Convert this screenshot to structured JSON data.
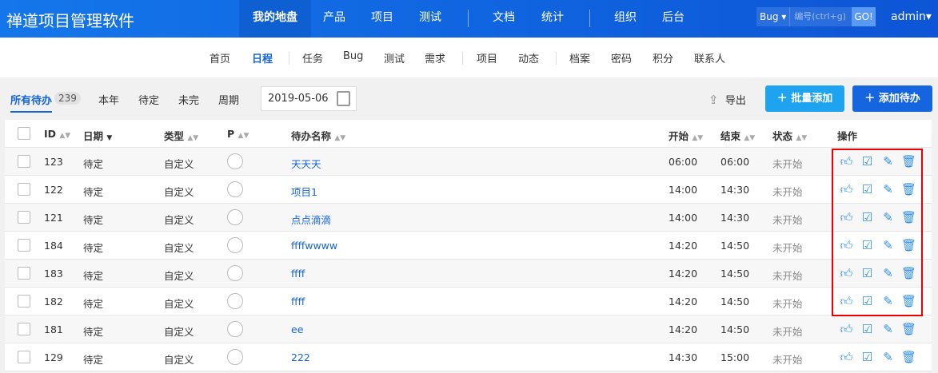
{
  "header": {
    "title": "禅道项目管理软件",
    "nav": [
      "我的地盘",
      "产品",
      "项目",
      "测试",
      "文档",
      "统计",
      "组织",
      "后台"
    ],
    "search_type": "Bug",
    "search_placeholder": "编号(ctrl+g)",
    "go": "GO!",
    "user": "admin"
  },
  "subnav": [
    "首页",
    "日程",
    "任务",
    "Bug",
    "测试",
    "需求",
    "项目",
    "动态",
    "档案",
    "密码",
    "积分",
    "联系人"
  ],
  "toolbar": {
    "filters": [
      "所有待办",
      "本年",
      "待定",
      "未完",
      "周期"
    ],
    "count": "239",
    "date": "2019-05-06",
    "export": "导出",
    "batch_add": "批量添加",
    "add": "添加待办"
  },
  "table": {
    "headers": [
      "ID",
      "日期",
      "类型",
      "P",
      "待办名称",
      "开始",
      "结束",
      "状态",
      "操作"
    ],
    "rows": [
      {
        "id": "123",
        "date": "待定",
        "type": "自定义",
        "name": "天天天",
        "start": "06:00",
        "end": "06:00",
        "status": "未开始"
      },
      {
        "id": "122",
        "date": "待定",
        "type": "自定义",
        "name": "项目1",
        "start": "14:00",
        "end": "14:30",
        "status": "未开始"
      },
      {
        "id": "121",
        "date": "待定",
        "type": "自定义",
        "name": "点点滴滴",
        "start": "14:00",
        "end": "14:30",
        "status": "未开始"
      },
      {
        "id": "184",
        "date": "待定",
        "type": "自定义",
        "name": "ffffwwww",
        "start": "14:20",
        "end": "14:50",
        "status": "未开始"
      },
      {
        "id": "183",
        "date": "待定",
        "type": "自定义",
        "name": "ffff",
        "start": "14:20",
        "end": "14:50",
        "status": "未开始"
      },
      {
        "id": "182",
        "date": "待定",
        "type": "自定义",
        "name": "ffff",
        "start": "14:20",
        "end": "14:50",
        "status": "未开始"
      },
      {
        "id": "181",
        "date": "待定",
        "type": "自定义",
        "name": "ee",
        "start": "14:20",
        "end": "14:50",
        "status": "未开始"
      },
      {
        "id": "129",
        "date": "待定",
        "type": "自定义",
        "name": "222",
        "start": "14:30",
        "end": "15:00",
        "status": "未开始"
      }
    ]
  },
  "colors": {
    "primary": "#1565d8",
    "highlight": "#ee0000"
  }
}
